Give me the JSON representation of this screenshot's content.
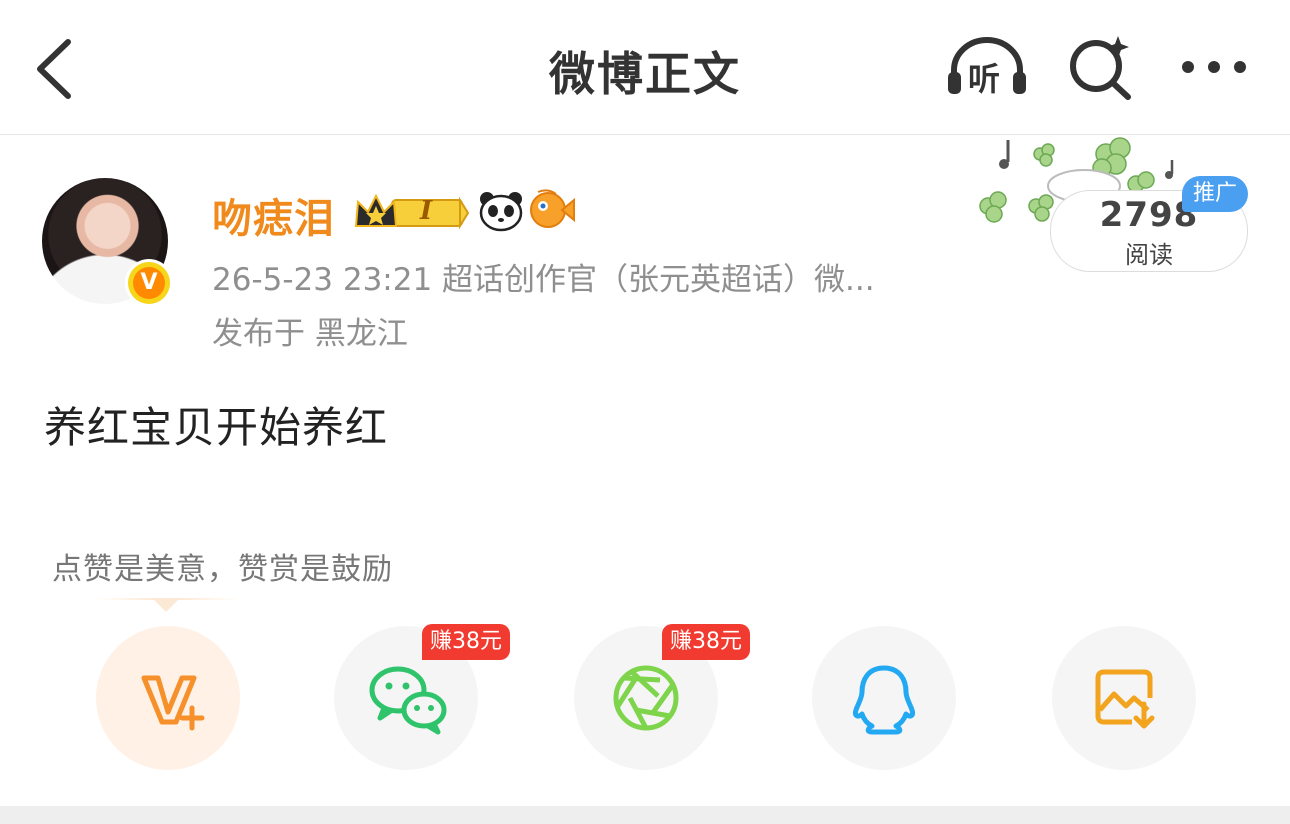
{
  "header": {
    "title": "微博正文",
    "listen_label": "听"
  },
  "post": {
    "username": "吻痣泪",
    "verified_badge": "V",
    "vip_level": "I",
    "meta_line": "26-5-23 23:21  超话创作官（张元英超话）微...",
    "location": "发布于 黑龙江",
    "content": "养红宝贝开始养红"
  },
  "read_count": {
    "number": "2798",
    "label": "阅读",
    "promo": "推广"
  },
  "tip": "点赞是美意，赞赏是鼓励",
  "share": {
    "wechat_earn": "赚38元",
    "moments_earn": "赚38元"
  },
  "colors": {
    "accent_orange": "#f08a1c",
    "promo_blue": "#4a9ff0",
    "earn_red": "#f23b30",
    "wechat_green": "#2fc36b",
    "qq_blue": "#23a8f2"
  },
  "icons": [
    "back-icon",
    "headphones-icon",
    "search-icon",
    "more-icon",
    "crown-icon",
    "panda-icon",
    "fish-icon",
    "v-plus-icon",
    "wechat-icon",
    "moments-icon",
    "qq-icon",
    "save-image-icon"
  ]
}
